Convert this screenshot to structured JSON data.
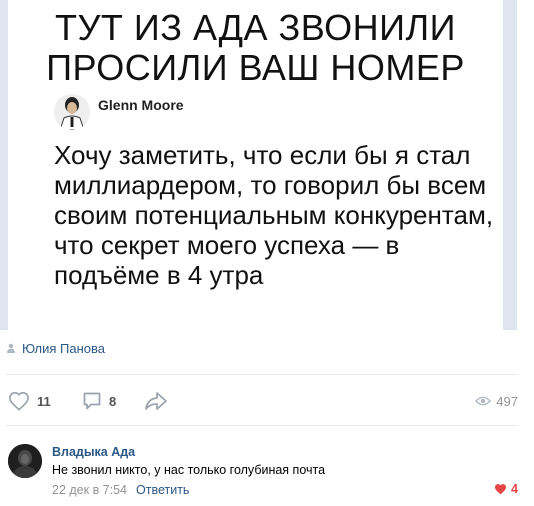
{
  "meme": {
    "title_line1": "ТУТ ИЗ АДА ЗВОНИЛИ",
    "title_line2": "ПРОСИЛИ ВАШ НОМЕР",
    "tweet_author": "Glenn Moore",
    "tweet_line1": "Хочу заметить, что если бы я стал",
    "tweet_line2": "миллиардером, то говорил бы всем",
    "tweet_line3": "своим потенциальным конкурентам,",
    "tweet_line4": "что секрет моего успеха — в",
    "tweet_line5": "подъёме в 4 утра"
  },
  "post": {
    "author": "Юлия Панова",
    "likes": "11",
    "comments": "8",
    "views": "497"
  },
  "comment": {
    "author": "Владыка Ада",
    "text": "Не звонил никто, у нас только голубиная почта",
    "date": "22 дек в 7:54",
    "reply_label": "Ответить",
    "likes": "4"
  },
  "colors": {
    "link": "#2a5885",
    "muted": "#939393",
    "like_red": "#e64646"
  }
}
